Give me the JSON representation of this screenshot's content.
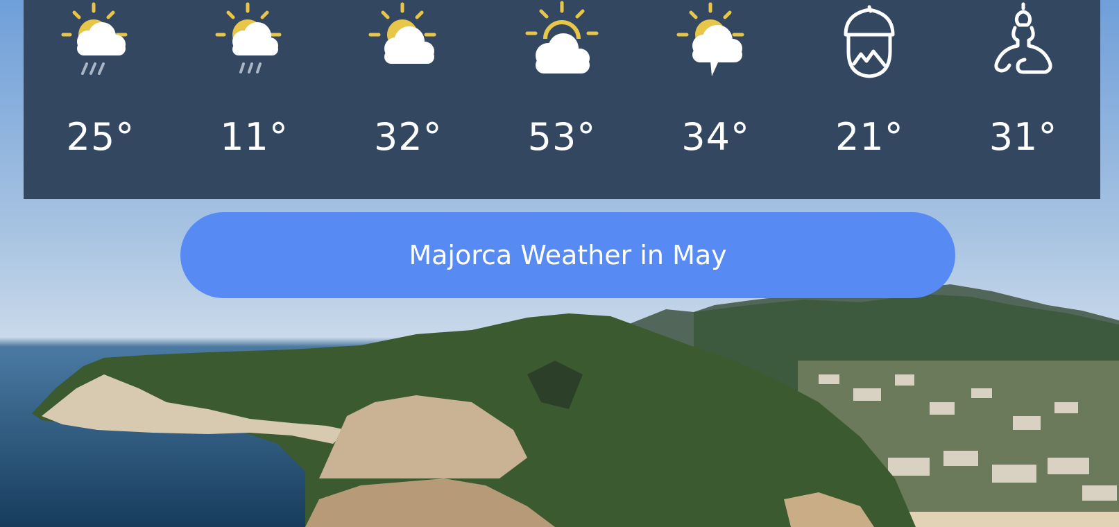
{
  "forecast": {
    "days": [
      {
        "icon": "sun-cloud-rain-icon",
        "temp": "25°"
      },
      {
        "icon": "sun-cloud-drizzle-icon",
        "temp": "11°"
      },
      {
        "icon": "sun-cloud-icon",
        "temp": "32°"
      },
      {
        "icon": "sun-behind-cloud-icon",
        "temp": "53°"
      },
      {
        "icon": "sun-cloud-thunder-icon",
        "temp": "34°"
      },
      {
        "icon": "acorn-mountain-icon",
        "temp": "21°"
      },
      {
        "icon": "meditation-figure-icon",
        "temp": "31°"
      }
    ]
  },
  "banner": {
    "title": "Majorca Weather in May"
  },
  "colors": {
    "panel": "#344760",
    "pill": "#578bf3",
    "sun": "#e8c64a",
    "cloud": "#ffffff",
    "rain": "#aab6c6"
  }
}
